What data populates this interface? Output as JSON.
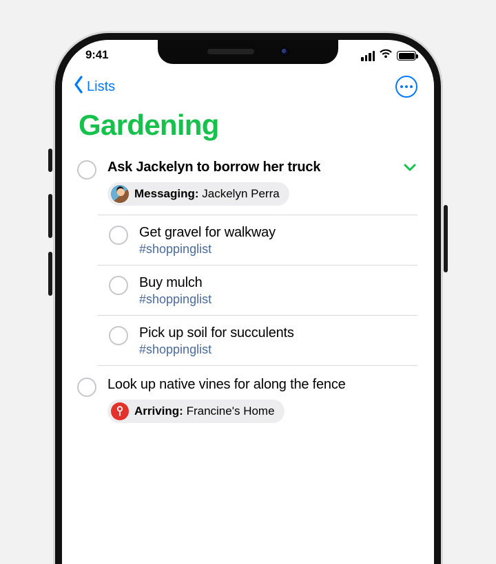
{
  "statusbar": {
    "time": "9:41"
  },
  "nav": {
    "back_label": "Lists"
  },
  "title": "Gardening",
  "accent_color": "#16c24b",
  "items": [
    {
      "title": "Ask Jackelyn to borrow her truck",
      "expanded": true,
      "pill": {
        "type": "messaging",
        "prefix": "Messaging:",
        "value": "Jackelyn Perra"
      },
      "subtasks": [
        {
          "title": "Get gravel for walkway",
          "tag": "#shoppinglist"
        },
        {
          "title": "Buy mulch",
          "tag": "#shoppinglist"
        },
        {
          "title": "Pick up soil for succulents",
          "tag": "#shoppinglist"
        }
      ]
    },
    {
      "title": "Look up native vines for along the fence",
      "pill": {
        "type": "location",
        "prefix": "Arriving:",
        "value": "Francine's Home"
      }
    }
  ]
}
